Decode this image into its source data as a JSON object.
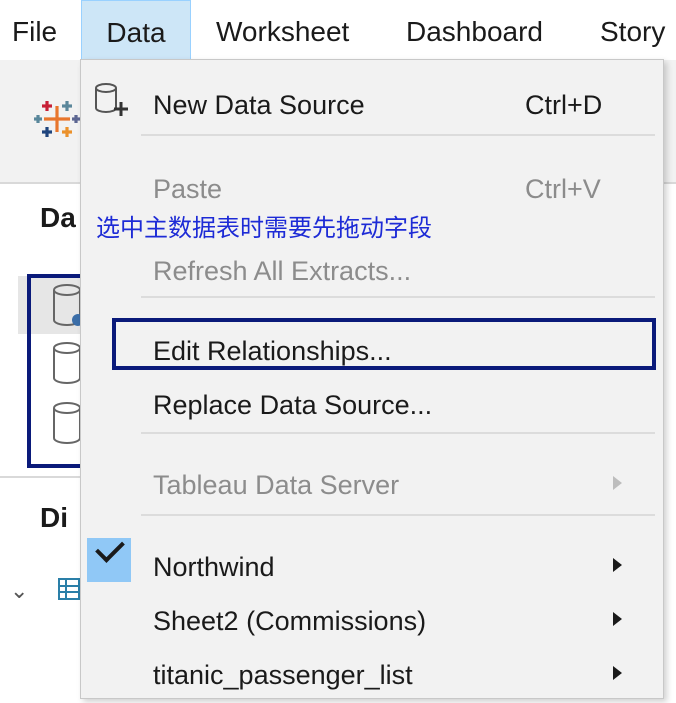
{
  "menubar": {
    "items": [
      {
        "label": "File"
      },
      {
        "label": "Data"
      },
      {
        "label": "Worksheet"
      },
      {
        "label": "Dashboard"
      },
      {
        "label": "Story"
      }
    ],
    "active": "Data"
  },
  "sidebar": {
    "title": "Da",
    "section2_title": "Di"
  },
  "data_menu": {
    "new_data_source": {
      "label": "New Data Source",
      "shortcut": "Ctrl+D"
    },
    "paste": {
      "label": "Paste",
      "shortcut": "Ctrl+V"
    },
    "refresh_all_extracts": {
      "label": "Refresh All Extracts..."
    },
    "edit_relationships": {
      "label": "Edit Relationships..."
    },
    "replace_data_source": {
      "label": "Replace Data Source..."
    },
    "tableau_data_server": {
      "label": "Tableau Data Server"
    },
    "sources": [
      {
        "label": "Northwind",
        "checked": true
      },
      {
        "label": "Sheet2 (Commissions)",
        "checked": false
      },
      {
        "label": "titanic_passenger_list",
        "checked": false
      }
    ]
  },
  "annotation": {
    "text": "选中主数据表时需要先拖动字段"
  },
  "colors": {
    "menu_bg": "#f2f2f2",
    "active_menu_bg": "#cde6f7",
    "check_bg": "#90c8f6",
    "highlight_box": "#0a1a7a",
    "annotation_text": "#1d2bd6"
  }
}
